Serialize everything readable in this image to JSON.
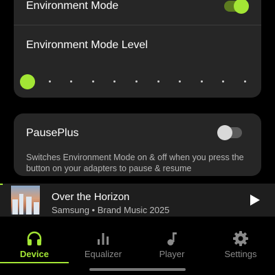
{
  "colors": {
    "accent": "#a3e635",
    "inactive": "#8a8a8a",
    "card": "#262626",
    "background": "#000000"
  },
  "environment_mode": {
    "title": "Environment Mode",
    "toggle_on": true,
    "level_title": "Environment Mode Level",
    "level_steps": 11,
    "level_value": 0
  },
  "pauseplus": {
    "title": "PausePlus",
    "toggle_on": false,
    "description": "Switches Environment Mode on & off when you press the button on your adapters to pause & resume"
  },
  "player": {
    "title": "Over the Horizon",
    "subtitle": "Samsung • Brand Music 2025",
    "art_icon": "album-art-cityscape",
    "play_icon": "play-icon"
  },
  "nav": {
    "items": [
      {
        "label": "Device",
        "icon": "headphones-icon",
        "active": true
      },
      {
        "label": "Equalizer",
        "icon": "equalizer-icon",
        "active": false
      },
      {
        "label": "Player",
        "icon": "music-note-icon",
        "active": false
      },
      {
        "label": "Settings",
        "icon": "gear-icon",
        "active": false
      }
    ]
  }
}
